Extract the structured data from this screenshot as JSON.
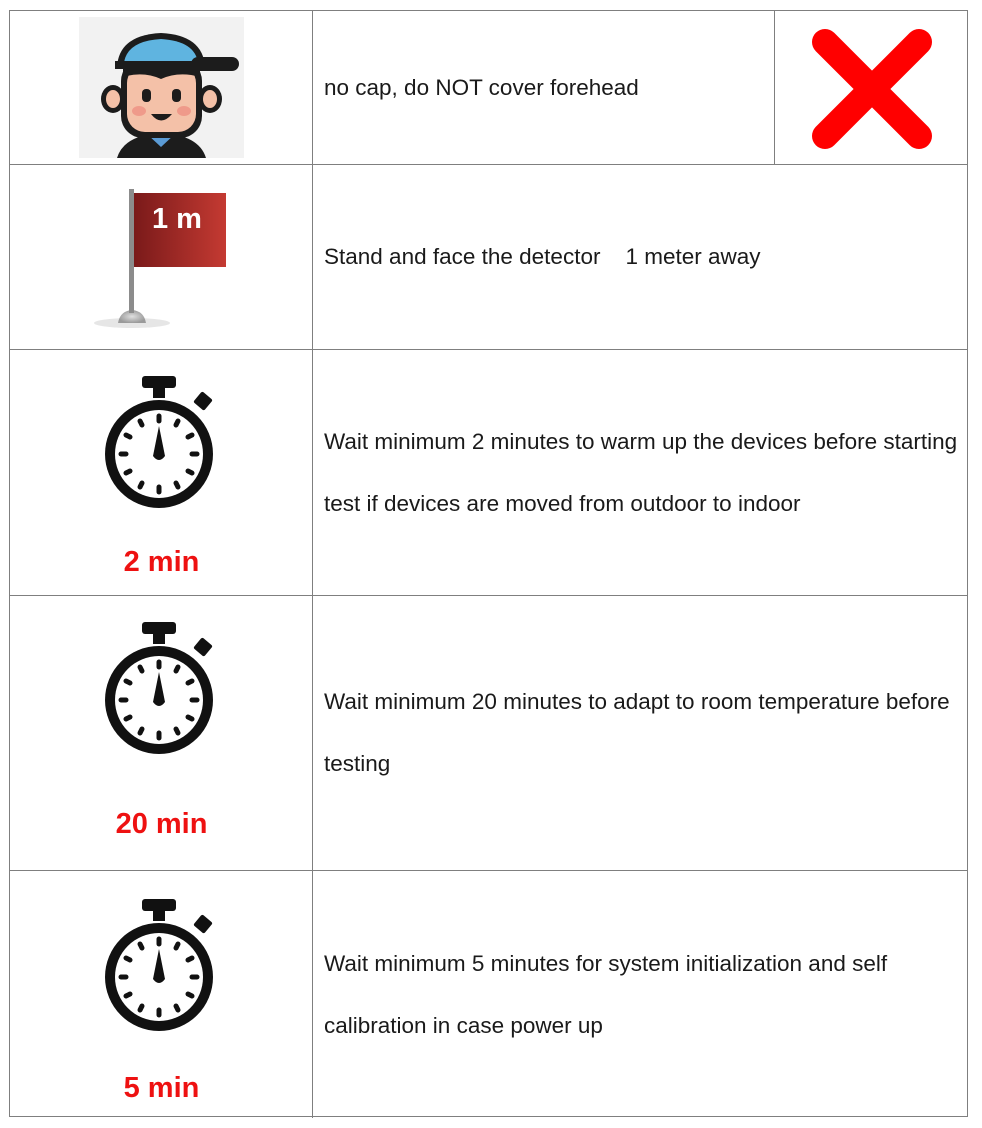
{
  "rows": [
    {
      "icon": "boy-with-cap-icon",
      "text": "no cap, do NOT cover forehead",
      "mark_icon": "red-x-icon",
      "mark_color": "#ff0000"
    },
    {
      "icon": "flag-icon",
      "flag_label": "1 m",
      "flag_color": "#a52a2a",
      "text": "Stand and face the detector    1 meter away"
    },
    {
      "icon": "stopwatch-icon",
      "time_label": "2 min",
      "text": "Wait minimum 2 minutes to warm up the devices before starting test if devices are moved from outdoor to indoor"
    },
    {
      "icon": "stopwatch-icon",
      "time_label": "20 min",
      "text": "Wait minimum 20 minutes to adapt to room temperature before testing"
    },
    {
      "icon": "stopwatch-icon",
      "time_label": "5 min",
      "text": "Wait minimum 5 minutes for system initialization and self calibration in case power up"
    }
  ],
  "colors": {
    "accent_red": "#ee1111",
    "border": "#7f7f7f"
  }
}
